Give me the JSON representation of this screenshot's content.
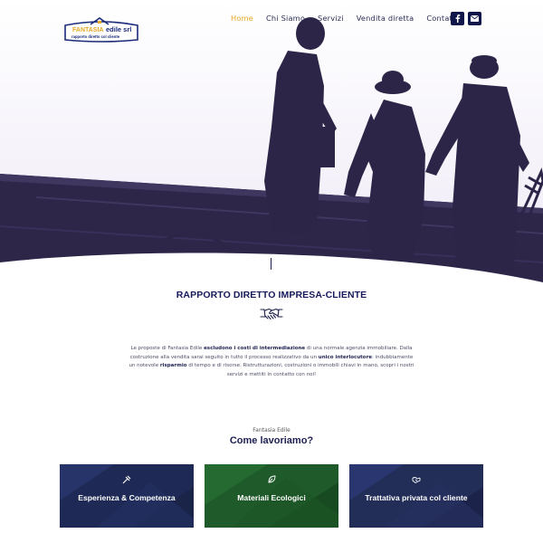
{
  "brand": {
    "name_part1": "FANTASIA",
    "name_part2": "edile srl",
    "tagline": "rapporto diretto col cliente"
  },
  "nav": {
    "items": [
      {
        "label": "Home",
        "active": true
      },
      {
        "label": "Chi Siamo",
        "active": false
      },
      {
        "label": "Servizi",
        "active": false
      },
      {
        "label": "Vendita diretta",
        "active": false
      },
      {
        "label": "Contatti",
        "active": false
      }
    ],
    "social": [
      "facebook-icon",
      "email-icon"
    ]
  },
  "colors": {
    "accent": "#e5a823",
    "navy": "#10154a",
    "silhouette": "#2c2547",
    "card_blue": "#1e2a55",
    "card_green": "#1f5a2a"
  },
  "intro": {
    "title": "RAPPORTO DIRETTO IMPRESA-CLIENTE",
    "icon": "handshake-icon",
    "p1": "Le proposte di Fantasia Edile ",
    "b1": "escludono i costi di intermediazione",
    "p2": " di una normale agenzia immobiliare. Dalla costruzione alla vendita sarai seguito in tutto il processo realizzativo da un ",
    "b2": "unico interlocutore",
    "p3": ": indubbiamente un notevole ",
    "b3": "risparmio",
    "p4": " di tempo e di risorse. Ristrutturazioni, costruzioni o immobili chiavi in mano, scopri i nostri servizi e mettiti in contatto con noi!"
  },
  "how": {
    "eyebrow": "Fantasia Edile",
    "title": "Come lavoriamo?"
  },
  "cards": [
    {
      "label": "Esperienza & Competenza",
      "icon": "tools-icon"
    },
    {
      "label": "Materiali Ecologici",
      "icon": "leaf-icon"
    },
    {
      "label": "Trattativa privata col cliente",
      "icon": "handshake-icon"
    }
  ]
}
